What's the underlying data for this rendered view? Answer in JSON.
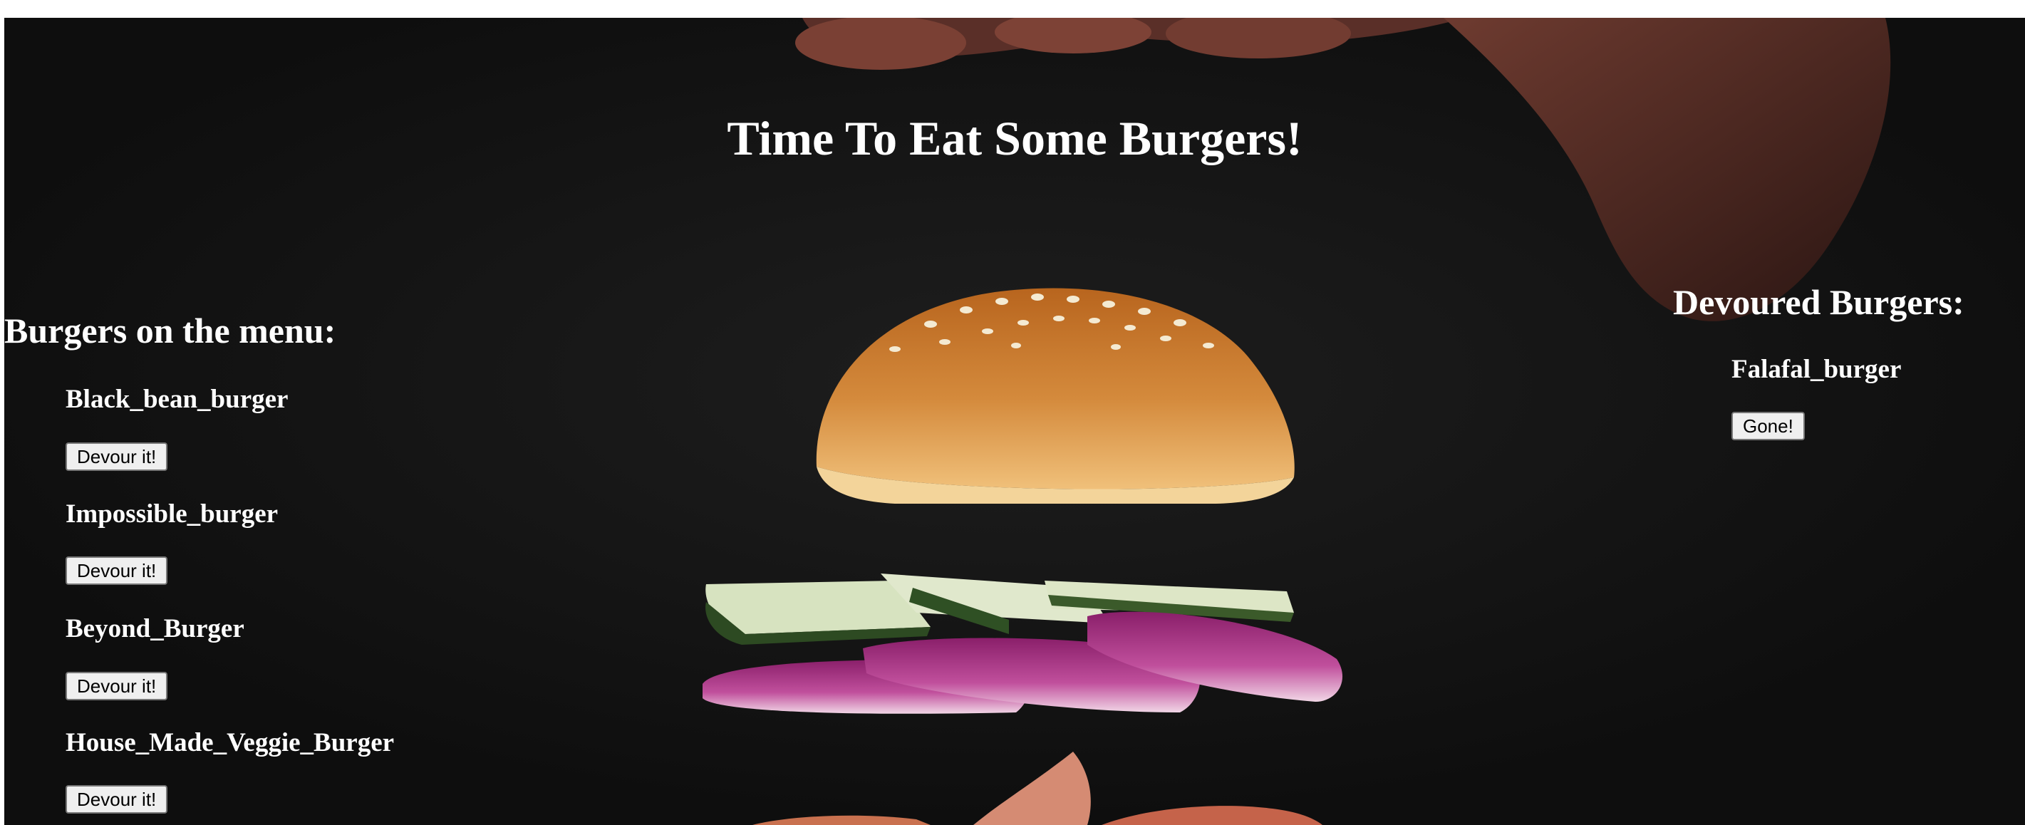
{
  "page": {
    "title": "Time To Eat Some Burgers!",
    "background_color": "#121212",
    "text_color": "#ffffff"
  },
  "menu": {
    "heading": "Burgers on the menu:",
    "items": [
      {
        "name": "Black_bean_burger",
        "button_label": "Devour it!"
      },
      {
        "name": "Impossible_burger",
        "button_label": "Devour it!"
      },
      {
        "name": "Beyond_Burger",
        "button_label": "Devour it!"
      },
      {
        "name": "House_Made_Veggie_Burger",
        "button_label": "Devour it!"
      }
    ]
  },
  "devoured": {
    "heading": "Devoured Burgers:",
    "items": [
      {
        "name": "Falafal_burger",
        "button_label": "Gone!"
      }
    ]
  }
}
